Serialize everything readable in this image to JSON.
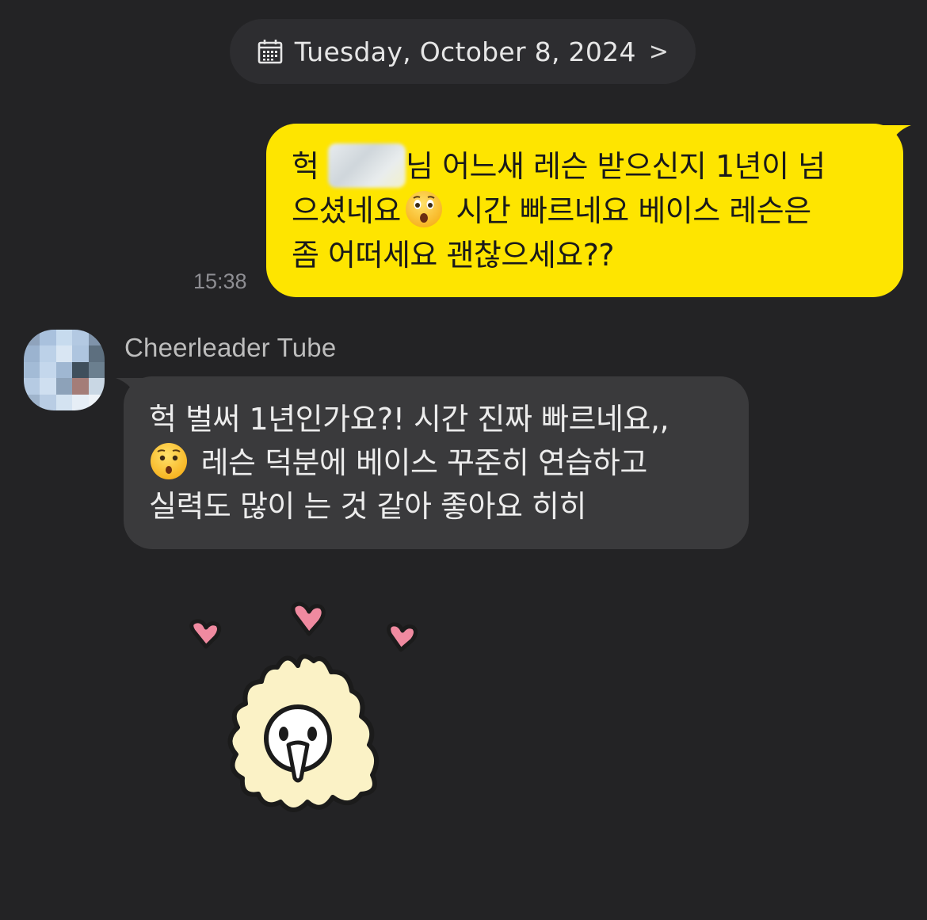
{
  "date_separator": {
    "label": "Tuesday, October 8, 2024",
    "icon": "calendar-icon",
    "chevron": ">"
  },
  "messages": [
    {
      "direction": "outgoing",
      "lines": [
        {
          "pre": "헉 ",
          "post": "님 어느새 레슨 받으신지 1년이 넘"
        },
        {
          "pre": "으셨네요",
          "emoji": "astonished-face",
          "post": " 시간 빠르네요 베이스 레슨은"
        },
        {
          "pre": "좀 어떠세요 괜찮으세요??"
        }
      ],
      "time": "15:38",
      "bubble_color": "#fee500"
    },
    {
      "direction": "incoming",
      "sender": "Cheerleader Tube",
      "lines": [
        {
          "pre": "헉 벌써 1년인가요?! 시간 진짜 빠르네요,,"
        },
        {
          "emoji": "hushed-face",
          "post": " 레슨 덕분에 베이스 꾸준히 연습하고"
        },
        {
          "pre": "실력도 많이 는 것 같아 좋아요 히히"
        }
      ],
      "bubble_color": "#3a3a3c"
    }
  ],
  "sticker": {
    "description_icon": "hearts-sticker-icon"
  },
  "colors": {
    "background": "#232325",
    "outgoing_bubble": "#fee500",
    "incoming_bubble": "#3a3a3c"
  }
}
